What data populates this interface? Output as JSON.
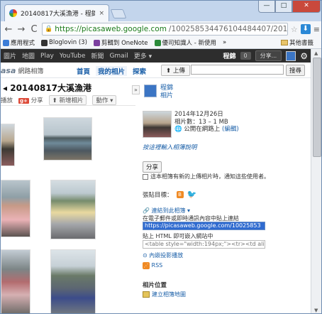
{
  "browser": {
    "tab_title": "20140817大溪漁港 - 程錦",
    "tab_close": "×",
    "window_min": "—",
    "window_max": "□",
    "window_close": "✕",
    "url_host": "https://picasaweb.google.com",
    "url_rest": "/100258534476104484407/20140",
    "back": "←",
    "forward": "→",
    "reload": "C",
    "menu": "≡"
  },
  "bookmarks": {
    "items": [
      {
        "label": "應用程式",
        "color": "#3b7dd8"
      },
      {
        "label": "Bloglovin (3)",
        "color": "#333333"
      },
      {
        "label": "剪輯到 OneNote",
        "color": "#7b3fa0"
      },
      {
        "label": "優司知識人 - 新使用",
        "color": "#2a8a3a"
      }
    ],
    "more": "»",
    "other": "其他書籤"
  },
  "googlebar": {
    "items": [
      "圖片",
      "地圖",
      "Play",
      "YouTube",
      "新聞",
      "Gmail",
      "更多 ▾"
    ],
    "user": "程錦",
    "count": "0",
    "share": "分享...",
    "gear": "⚙"
  },
  "picasa": {
    "logo": "asa",
    "logo_sub": "網路相簿",
    "tabs": [
      "首頁",
      "我的相片",
      "探索"
    ],
    "upload": "上傳",
    "search_button": "搜尋"
  },
  "album": {
    "title": "20140817大溪漁港",
    "tool1": "播放",
    "gplus": "g+",
    "share": "分享",
    "add_photo": "新增相片",
    "actions": "動作 ▾",
    "collapse": "»",
    "back_arrow": "◂"
  },
  "panel": {
    "owner_line1": "程錦",
    "owner_line2": "相片",
    "date": "2014年12月26日",
    "count": "相片數：13 – 1 MB",
    "visibility": "公開在網路上",
    "edit": "(編輯)",
    "desc_link": "按這裡輸入相簿說明",
    "share_button": "分享",
    "notify": "這本相簿有新的上傳相片時，通知這些使用者。",
    "tag_label": "張貼目標：",
    "link_label": "連結到此相簿 ▾",
    "link_hint": "在電子郵件或即時通訊內容中貼上連結",
    "link_url": "https://picasaweb.google.com/10025853",
    "embed_hint": "貼上 HTML 即可嵌入網站中",
    "embed_code": "<table style=\"width:194px;\"><tr><td align",
    "slideshow": "內嵌投影播放",
    "rss": "RSS",
    "position_title": "相片位置",
    "create_map": "建立相簿地圖"
  }
}
